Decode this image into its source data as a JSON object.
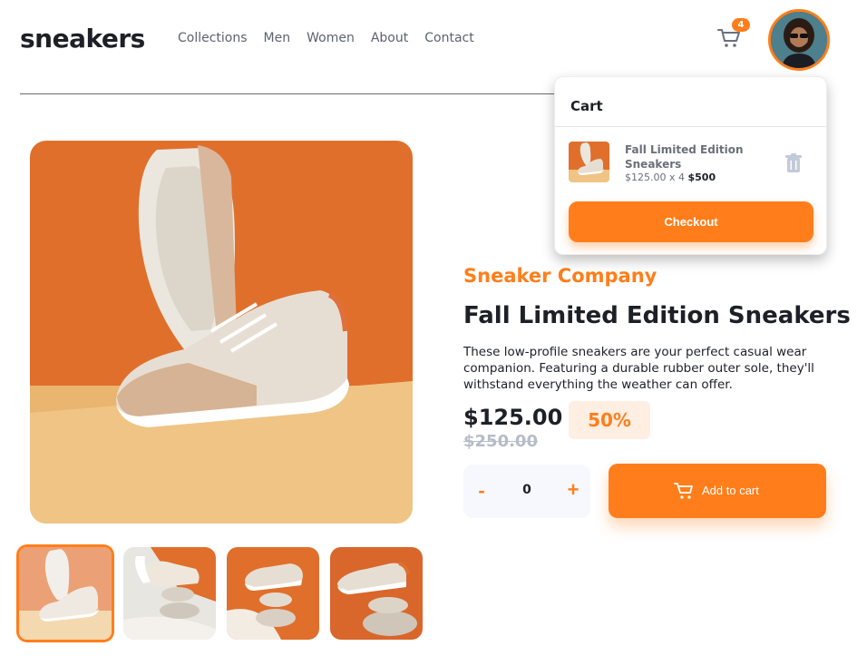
{
  "header": {
    "logo": "sneakers",
    "nav": [
      "Collections",
      "Men",
      "Women",
      "About",
      "Contact"
    ],
    "cart_count": "4",
    "avatar_icon": "user-avatar-icon"
  },
  "cart": {
    "title": "Cart",
    "item": {
      "name": "Fall Limited Edition Sneakers",
      "price_line": "$125.00 x 4",
      "total": "$500"
    },
    "checkout_label": "Checkout"
  },
  "product": {
    "company": "Sneaker Company",
    "title": "Fall Limited Edition Sneakers",
    "description": "These low-profile sneakers are your perfect casual wear companion. Featuring a durable rubber outer sole, they'll withstand everything the weather can offer.",
    "price": "$125.00",
    "discount": "50%",
    "original_price": "$250.00"
  },
  "quantity": {
    "minus": "-",
    "value": "0",
    "plus": "+"
  },
  "add_to_cart_label": "Add to cart",
  "colors": {
    "accent": "#ff7e1b",
    "accent_light": "#ffeee2",
    "dark": "#1d2026",
    "muted": "#b6bcc8"
  }
}
